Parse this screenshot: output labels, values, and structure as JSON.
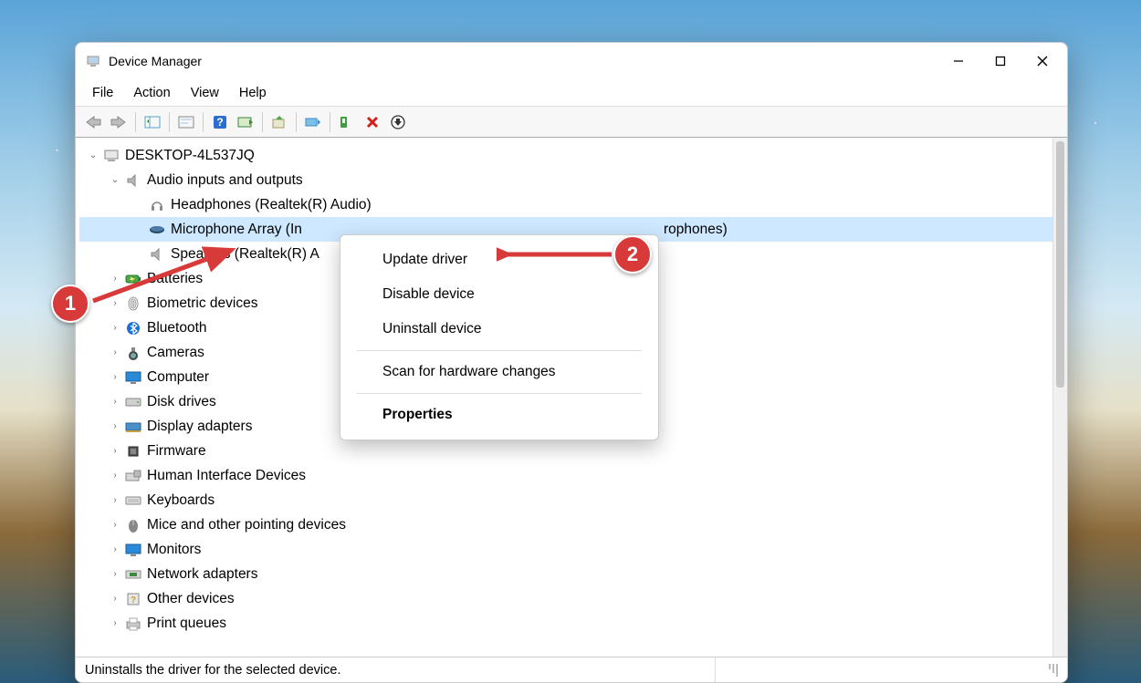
{
  "window": {
    "title": "Device Manager"
  },
  "menu": {
    "file": "File",
    "action": "Action",
    "view": "View",
    "help": "Help"
  },
  "tree": {
    "root": "DESKTOP-4L537JQ",
    "audio": {
      "label": "Audio inputs and outputs",
      "headphones": "Headphones (Realtek(R) Audio)",
      "mic_prefix": "Microphone Array (In",
      "mic_suffix": "rophones)",
      "speakers": "Speakers (Realtek(R) A"
    },
    "cat": {
      "batteries": "Batteries",
      "biometric": "Biometric devices",
      "bluetooth": "Bluetooth",
      "cameras": "Cameras",
      "computer": "Computer",
      "disk": "Disk drives",
      "display": "Display adapters",
      "firmware": "Firmware",
      "hid": "Human Interface Devices",
      "keyboards": "Keyboards",
      "mice": "Mice and other pointing devices",
      "monitors": "Monitors",
      "network": "Network adapters",
      "other": "Other devices",
      "print": "Print queues"
    }
  },
  "context_menu": {
    "update": "Update driver",
    "disable": "Disable device",
    "uninstall": "Uninstall device",
    "scan": "Scan for hardware changes",
    "properties": "Properties"
  },
  "statusbar": {
    "text": "Uninstalls the driver for the selected device."
  },
  "callouts": {
    "one": "1",
    "two": "2"
  }
}
